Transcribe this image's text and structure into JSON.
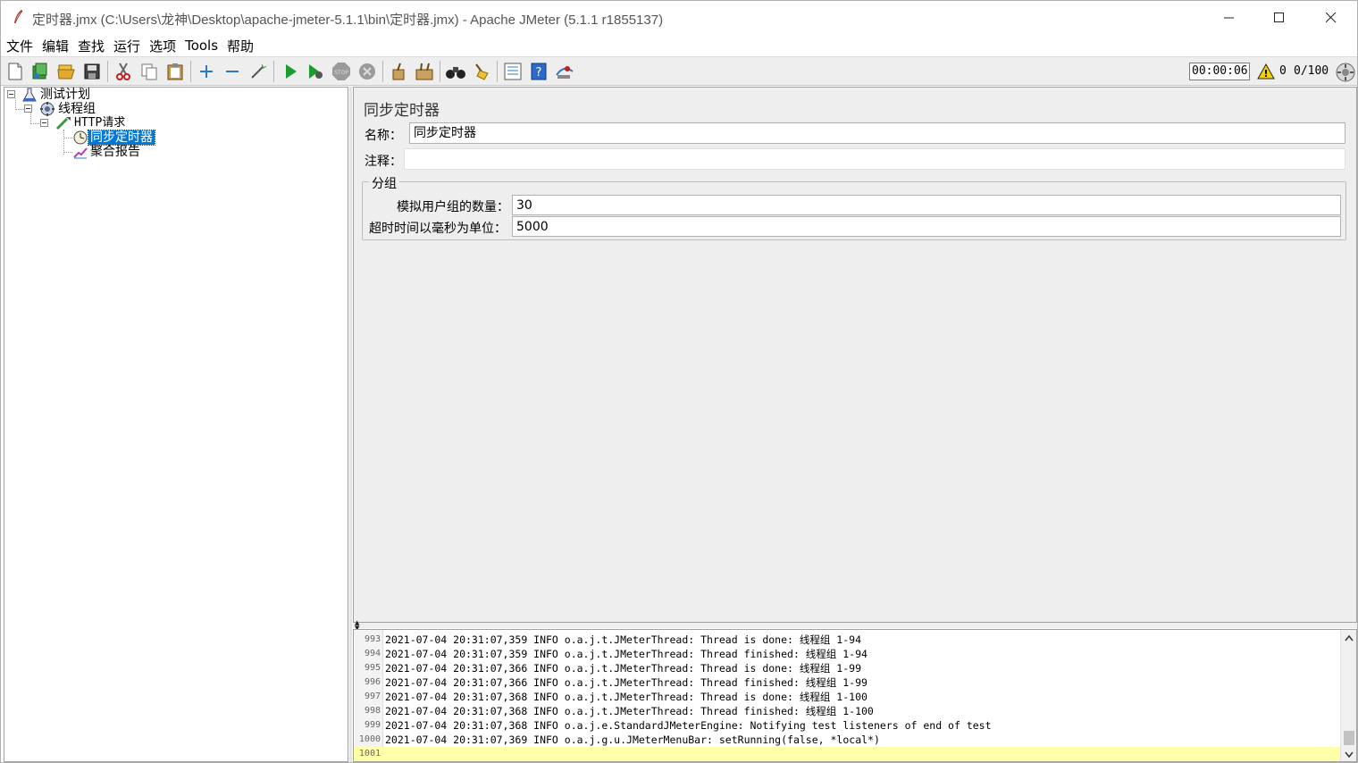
{
  "window": {
    "title": "定时器.jmx (C:\\Users\\龙神\\Desktop\\apache-jmeter-5.1.1\\bin\\定时器.jmx) - Apache JMeter (5.1.1 r1855137)"
  },
  "menu": {
    "items": [
      "文件",
      "编辑",
      "查找",
      "运行",
      "选项",
      "Tools",
      "帮助"
    ]
  },
  "toolbar": {
    "timer": "00:00:06",
    "warning_count": "0",
    "thread_count": "0/100",
    "icons": [
      "new",
      "templates",
      "open",
      "save",
      "cut",
      "copy",
      "paste",
      "expand-all",
      "collapse-all",
      "toggle",
      "start",
      "start-no-pauses",
      "stop",
      "shutdown",
      "clear",
      "clear-all",
      "search",
      "reset-search",
      "function-helper",
      "help",
      "remote-start"
    ]
  },
  "tree": {
    "nodes": [
      {
        "label": "测试计划",
        "icon": "test-plan"
      },
      {
        "label": "线程组",
        "icon": "thread-group"
      },
      {
        "label": "HTTP请求",
        "icon": "http-sampler"
      },
      {
        "label": "同步定时器",
        "icon": "timer",
        "selected": true
      },
      {
        "label": "聚合报告",
        "icon": "listener"
      }
    ]
  },
  "panel": {
    "title": "同步定时器",
    "name_label": "名称：",
    "name_value": "同步定时器",
    "comment_label": "注释：",
    "comment_value": "",
    "group_legend": "分组",
    "users_label": "模拟用户组的数量：",
    "users_value": "30",
    "timeout_label": "超时时间以毫秒为单位：",
    "timeout_value": "5000"
  },
  "log": {
    "lines": [
      {
        "n": "993",
        "text": "2021-07-04 20:31:07,359 INFO o.a.j.t.JMeterThread: Thread is done: 线程组 1-94"
      },
      {
        "n": "994",
        "text": "2021-07-04 20:31:07,359 INFO o.a.j.t.JMeterThread: Thread finished: 线程组 1-94"
      },
      {
        "n": "995",
        "text": "2021-07-04 20:31:07,366 INFO o.a.j.t.JMeterThread: Thread is done: 线程组 1-99"
      },
      {
        "n": "996",
        "text": "2021-07-04 20:31:07,366 INFO o.a.j.t.JMeterThread: Thread finished: 线程组 1-99"
      },
      {
        "n": "997",
        "text": "2021-07-04 20:31:07,368 INFO o.a.j.t.JMeterThread: Thread is done: 线程组 1-100"
      },
      {
        "n": "998",
        "text": "2021-07-04 20:31:07,368 INFO o.a.j.t.JMeterThread: Thread finished: 线程组 1-100"
      },
      {
        "n": "999",
        "text": "2021-07-04 20:31:07,368 INFO o.a.j.e.StandardJMeterEngine: Notifying test listeners of end of test"
      },
      {
        "n": "1000",
        "text": "2021-07-04 20:31:07,369 INFO o.a.j.g.u.JMeterMenuBar: setRunning(false, *local*)"
      },
      {
        "n": "1001",
        "text": ""
      }
    ]
  }
}
